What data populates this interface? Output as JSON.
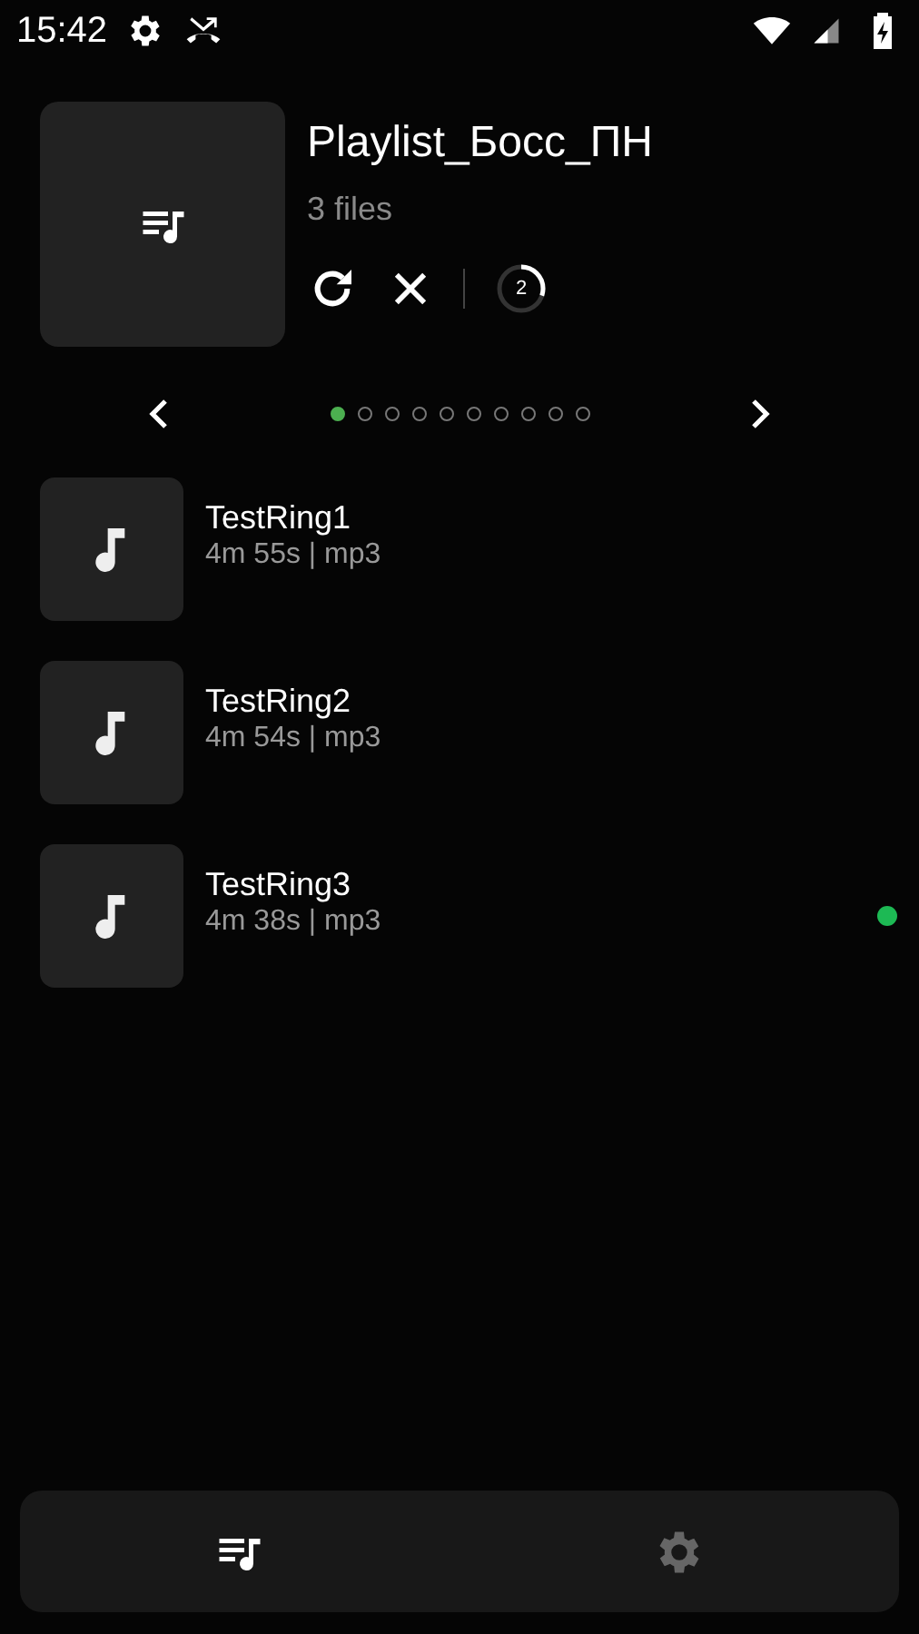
{
  "status_bar": {
    "time": "15:42"
  },
  "playlist": {
    "title": "Playlist_Босс_ПН",
    "count": "3 files",
    "progress": {
      "label": "2",
      "level": 0.3
    }
  },
  "pager": {
    "pages": [
      {
        "selected": true
      },
      {
        "selected": false
      },
      {
        "selected": false
      },
      {
        "selected": false
      },
      {
        "selected": false
      },
      {
        "selected": false
      },
      {
        "selected": false
      },
      {
        "selected": false
      },
      {
        "selected": false
      },
      {
        "selected": false
      }
    ]
  },
  "tracks": [
    {
      "title": "TestRing1",
      "details": "4m 55s | mp3",
      "playing": false
    },
    {
      "title": "TestRing2",
      "details": "4m 54s | mp3",
      "playing": false
    },
    {
      "title": "TestRing3",
      "details": "4m 38s | mp3",
      "playing": true
    }
  ],
  "bottom_nav": [
    {
      "kind": "playlists",
      "selected": true
    },
    {
      "kind": "settings",
      "selected": false
    }
  ]
}
